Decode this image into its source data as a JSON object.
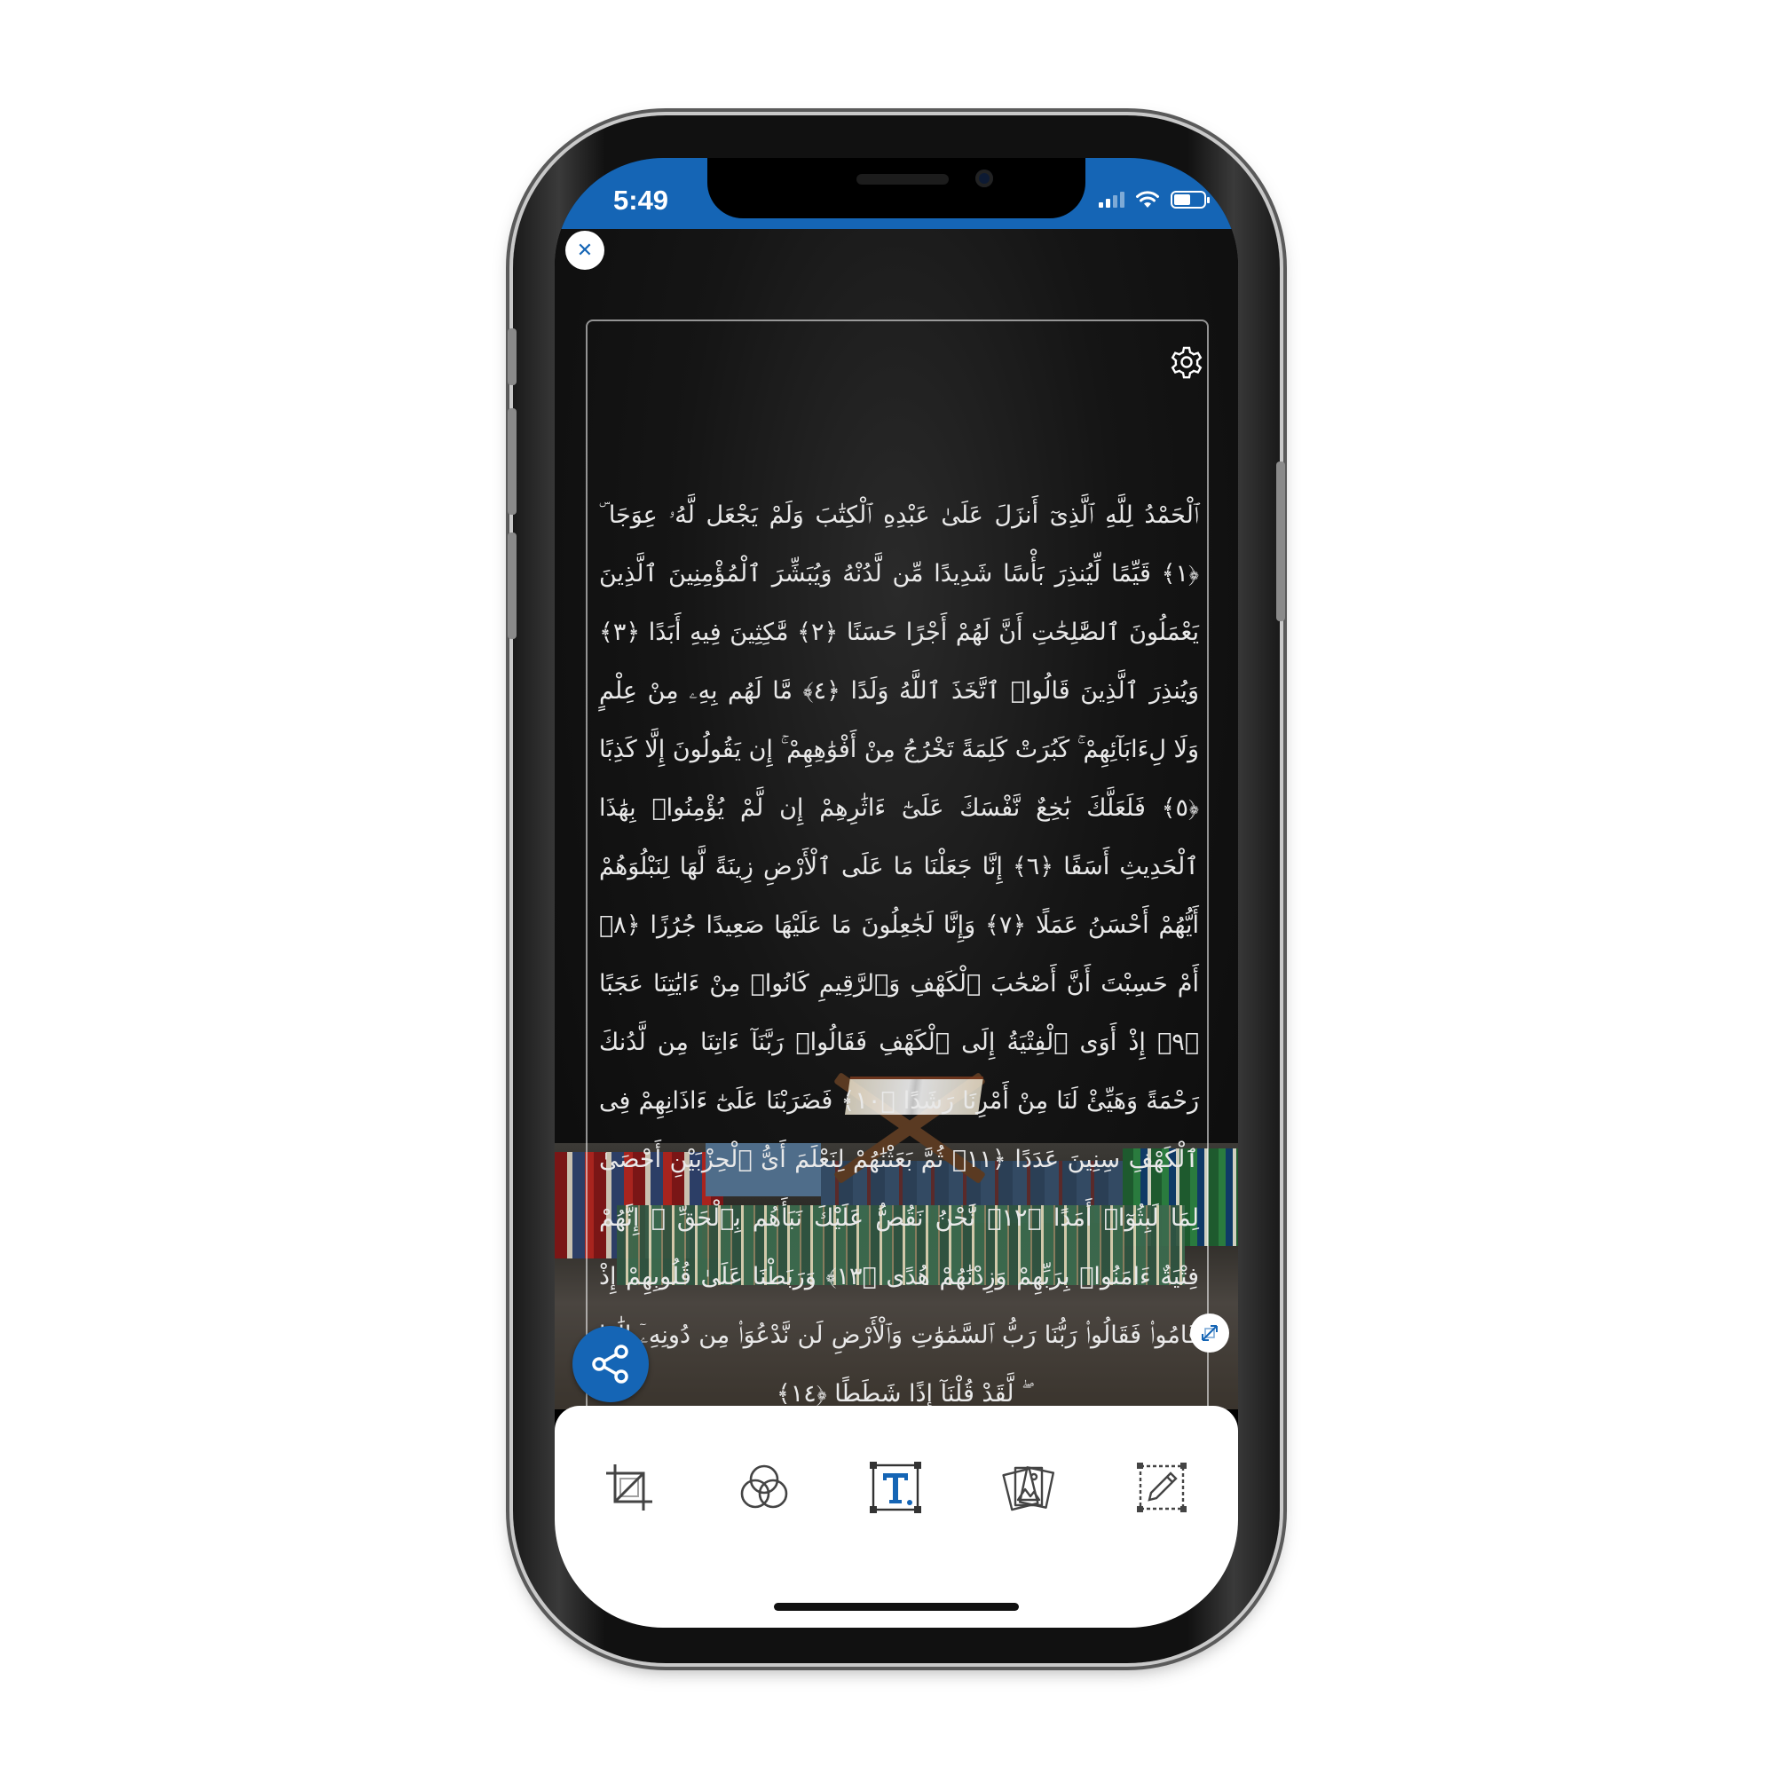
{
  "status_bar": {
    "time": "5:49",
    "background_color": "#1565b5",
    "icons": [
      "signal-icon",
      "wifi-icon",
      "battery-icon"
    ],
    "battery_level": 0.55
  },
  "editor": {
    "icons": {
      "close": "close-icon",
      "settings": "gear-icon",
      "resize": "resize-icon",
      "share": "share-icon"
    },
    "verses": [
      "ٱلْحَمْدُ لِلَّهِ ٱلَّذِىٓ أَنزَلَ عَلَىٰ عَبْدِهِ ٱلْكِتَٰبَ وَلَمْ يَجْعَل لَّهُۥ عِوَجَا ۜ ﴿١﴾ قَيِّمًا لِّيُنذِرَ بَأْسًا شَدِيدًا مِّن لَّدُنْهُ وَيُبَشِّرَ ٱلْمُؤْمِنِينَ ٱلَّذِينَ يَعْمَلُونَ ٱلصَّٰلِحَٰتِ أَنَّ لَهُمْ أَجْرًا حَسَنًا ﴿٢﴾ مَّٰكِثِينَ فِيهِ أَبَدًا ﴿٣﴾ وَيُنذِرَ ٱلَّذِينَ قَالُوا۟ ٱتَّخَذَ ٱللَّهُ وَلَدًا ﴿٤﴾ مَّا لَهُم بِهِۦ مِنْ عِلْمٍ وَلَا لِءَابَآئِهِمْ ۚ كَبُرَتْ كَلِمَةً تَخْرُجُ مِنْ أَفْوَٰهِهِمْ ۚ إِن يَقُولُونَ إِلَّا كَذِبًا ﴿٥﴾ فَلَعَلَّكَ بَٰخِعٌ نَّفْسَكَ عَلَىٰٓ ءَاثَٰرِهِمْ إِن لَّمْ يُؤْمِنُوا۟ بِهَٰذَا ٱلْحَدِيثِ أَسَفًا ﴿٦﴾ إِنَّا جَعَلْنَا مَا عَلَى ٱلْأَرْضِ زِينَةً لَّهَا لِنَبْلُوَهُمْ أَيُّهُمْ أَحْسَنُ عَمَلًا ﴿٧﴾ وَإِنَّا لَجَٰعِلُونَ مَا عَلَيْهَا صَعِيدًا جُرُزًا ﴿٨﴾ أَمْ حَسِبْتَ أَنَّ أَصْحَٰبَ ٱلْكَهْفِ وَٱلرَّقِيمِ كَانُوا۟ مِنْ ءَايَٰتِنَا عَجَبًا ﴿٩﴾ إِذْ أَوَى ٱلْفِتْيَةُ إِلَى ٱلْكَهْفِ فَقَالُوا۟ رَبَّنَآ ءَاتِنَا مِن لَّدُنكَ رَحْمَةً وَهَيِّئْ لَنَا مِنْ أَمْرِنَا رَشَدًا ﴿١٠﴾ فَضَرَبْنَا عَلَىٰٓ ءَاذَانِهِمْ فِى ٱلْكَهْفِ سِنِينَ عَدَدًا ﴿١١﴾ ثُمَّ بَعَثْنَٰهُمْ لِنَعْلَمَ أَىُّ ٱلْحِزْبَيْنِ أَحْصَىٰ لِمَا لَبِثُوٓا۟ أَمَدًا ﴿١٢﴾ نَّحْنُ نَقُصُّ عَلَيْكَ نَبَأَهُم بِٱلْحَقِّ ۚ إِنَّهُمْ فِتْيَةٌ ءَامَنُوا۟ بِرَبِّهِمْ وَزِدْنَٰهُمْ هُدًى ﴿١٣﴾ وَرَبَطْنَا عَلَىٰ قُلُوبِهِمْ إِذْ قَامُوا۟ فَقَالُوا۟ رَبُّنَا رَبُّ ٱلسَّمَٰوَٰتِ وَٱلْأَرْضِ لَن نَّدْعُوَا۟ مِن دُونِهِۦٓ إِلَٰهًا ۖ لَّقَدْ قُلْنَآ إِذًا شَطَطًا ﴿١٤﴾"
    ],
    "text_color": "#e9e9e9"
  },
  "toolbar": {
    "tools": [
      {
        "name": "crop",
        "icon": "crop-icon"
      },
      {
        "name": "filters",
        "icon": "filters-icon"
      },
      {
        "name": "text",
        "icon": "text-icon"
      },
      {
        "name": "backgrounds",
        "icon": "image-gallery-icon"
      },
      {
        "name": "edit",
        "icon": "edit-icon"
      }
    ],
    "accent_color": "#1565b5"
  }
}
